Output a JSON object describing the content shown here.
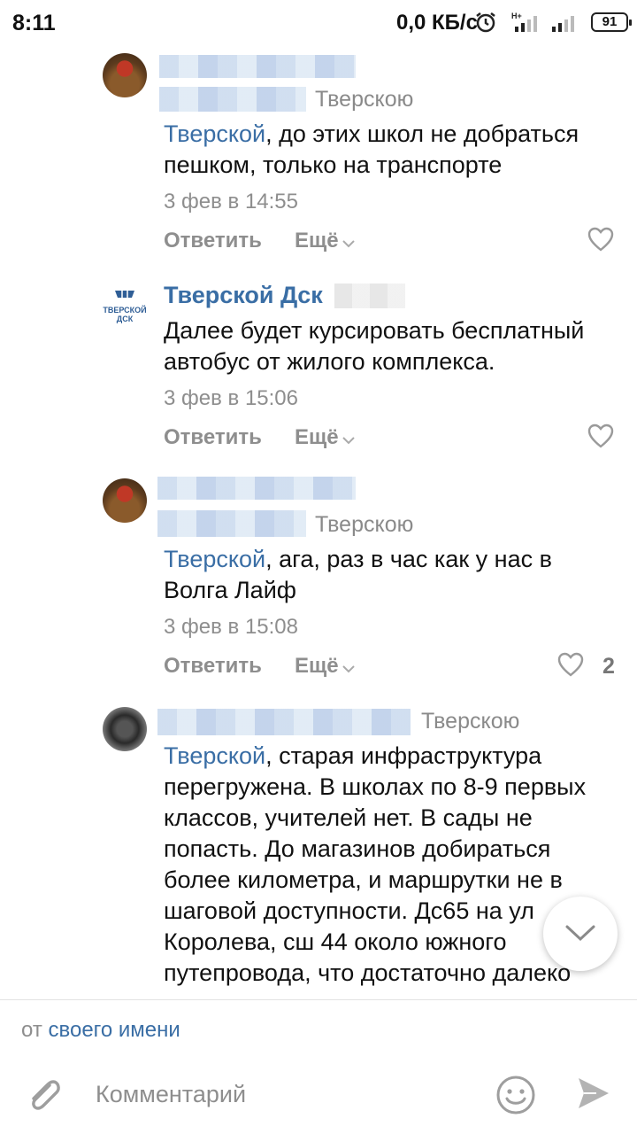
{
  "status_bar": {
    "time": "8:11",
    "network_speed": "0,0 КБ/с",
    "battery": "91"
  },
  "comments": [
    {
      "reply_to": "Тверскою",
      "mention": "Тверской",
      "text": ", до этих школ не добраться пешком, только на транспорте",
      "date": "3 фев в 14:55",
      "reply_label": "Ответить",
      "more_label": "Ещё",
      "likes": ""
    },
    {
      "author": "Тверской Дск",
      "text": "Далее будет курсировать бесплатный автобус от жилого комплекса.",
      "date": "3 фев в 15:06",
      "reply_label": "Ответить",
      "more_label": "Ещё",
      "likes": ""
    },
    {
      "reply_to": "Тверскою",
      "mention": "Тверской",
      "text": ", ага, раз в час как у нас в Волга Лайф",
      "date": "3 фев в 15:08",
      "reply_label": "Ответить",
      "more_label": "Ещё",
      "likes": "2"
    },
    {
      "reply_to": "Тверскою",
      "mention": "Тверской",
      "text": ", старая инфраструктура перегружена. В школах по 8-9 первых классов, учителей нет. В сады не попасть. До магазинов добираться более километра, и маршрутки не в шаговой доступности. Дс65 на ул Королева, сш 44 около южного путепровода, что достаточно далеко"
    }
  ],
  "composer": {
    "from_prefix": "от",
    "from_link": "своего имени",
    "placeholder": "Комментарий"
  },
  "colors": {
    "accent": "#3a6ea5",
    "muted": "#8e8e8e"
  }
}
